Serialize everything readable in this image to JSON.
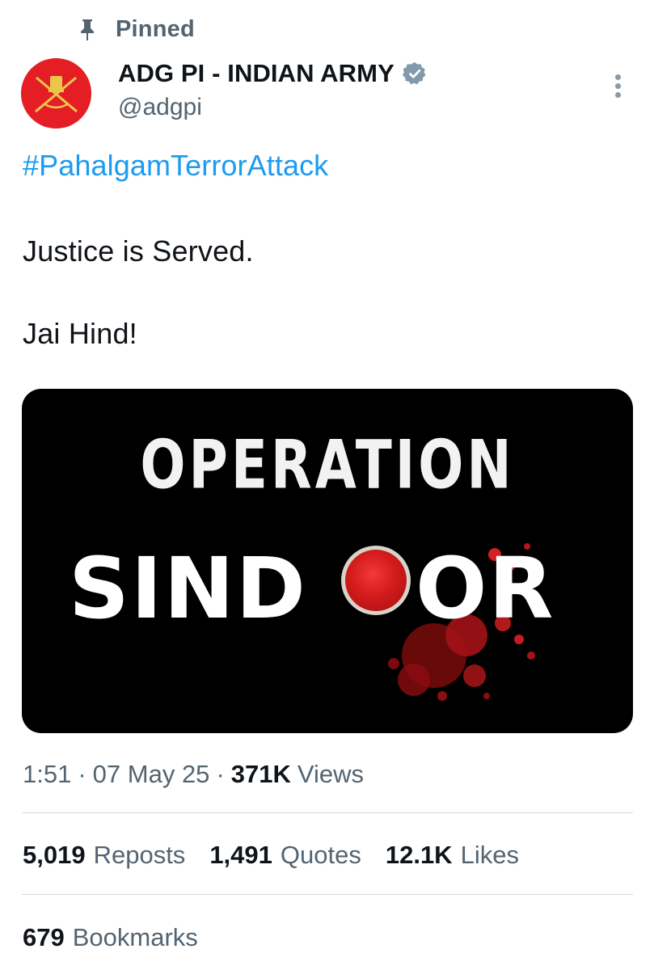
{
  "pinned": {
    "label": "Pinned",
    "icon": "pin-icon"
  },
  "author": {
    "display_name": "ADG PI - INDIAN ARMY",
    "handle": "@adgpi",
    "verified_icon": "verified-badge-icon",
    "avatar_color": "#e51e25"
  },
  "post": {
    "hashtag": "#PahalgamTerrorAttack",
    "lines": [
      "Justice is Served.",
      "Jai Hind!"
    ],
    "media": {
      "title_line": "OPERATION",
      "word_left": "SIND",
      "word_right": "OR"
    }
  },
  "meta": {
    "time": "1:51",
    "date": "07 May 25",
    "views_count": "371K",
    "views_label": "Views",
    "separator": "·"
  },
  "stats": {
    "reposts": {
      "count": "5,019",
      "label": "Reposts"
    },
    "quotes": {
      "count": "1,491",
      "label": "Quotes"
    },
    "likes": {
      "count": "12.1K",
      "label": "Likes"
    }
  },
  "bookmarks": {
    "count": "679",
    "label": "Bookmarks"
  },
  "colors": {
    "link": "#1d9bf0",
    "muted": "#536471",
    "text": "#0f1419",
    "divider": "#cfd9de"
  }
}
